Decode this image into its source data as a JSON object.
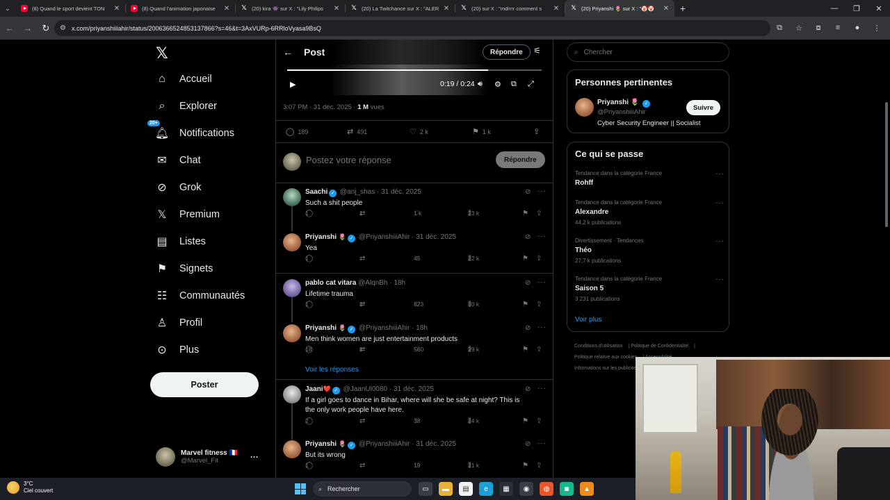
{
  "browser": {
    "tabs": [
      {
        "title": "(8) Quand le sport devient TON",
        "icon": "youtube-icon",
        "active": false
      },
      {
        "title": "(8) Quand l'animation japonaise",
        "icon": "youtube-icon",
        "active": false
      },
      {
        "title": "(20) kira 👾 sur X : \"Lily Philips",
        "icon": "x-icon",
        "active": false
      },
      {
        "title": "(20) La Twitchance sur X : \"ALER",
        "icon": "x-icon",
        "active": false
      },
      {
        "title": "(20) sur X : \"mdrrrr comment s",
        "icon": "x-icon",
        "active": false
      },
      {
        "title": "(20) Priyanshi 🌷 sur X : \"🤡🤡",
        "icon": "x-icon",
        "active": true
      }
    ],
    "url": "x.com/priyanshiiiahir/status/2006366524853137866?s=46&t=3AxVURp-6RRloVyasa9BsQ"
  },
  "nav": {
    "items": [
      {
        "label": "Accueil",
        "icon": "home-icon",
        "glyph": "⌂"
      },
      {
        "label": "Explorer",
        "icon": "search-icon",
        "glyph": "⌕"
      },
      {
        "label": "Notifications",
        "icon": "bell-icon",
        "glyph": "🔔︎"
      },
      {
        "label": "Chat",
        "icon": "mail-icon",
        "glyph": "✉"
      },
      {
        "label": "Grok",
        "icon": "grok-icon",
        "glyph": "⊘"
      },
      {
        "label": "Premium",
        "icon": "x-premium-icon",
        "glyph": "𝕏"
      },
      {
        "label": "Listes",
        "icon": "list-icon",
        "glyph": "▤"
      },
      {
        "label": "Signets",
        "icon": "bookmark-icon",
        "glyph": "⚑"
      },
      {
        "label": "Communautés",
        "icon": "communities-icon",
        "glyph": "☷"
      },
      {
        "label": "Profil",
        "icon": "profile-icon",
        "glyph": "♙"
      },
      {
        "label": "Plus",
        "icon": "more-circle-icon",
        "glyph": "⊙"
      }
    ],
    "notif_badge": "20+",
    "post_button": "Poster",
    "account": {
      "name": "Marvel fitness 🇫🇷",
      "handle": "@Marvel_Fit"
    }
  },
  "post": {
    "header_title": "Post",
    "reply_button": "Répondre",
    "video": {
      "time": "0:19 / 0:24",
      "progress": 0.79
    },
    "timestamp": "3:07 PM · 31 déc. 2025 · ",
    "views_count": "1 M",
    "views_label": " vues",
    "stats": {
      "replies": "189",
      "reposts": "491",
      "likes": "2 k",
      "bookmarks": "1 k"
    },
    "compose_placeholder": "Postez votre réponse",
    "compose_button": "Répondre"
  },
  "replies": [
    {
      "name": "Saachi",
      "handle": "@anj_shas · 31 déc. 2025",
      "text": "Such a shit people",
      "r": "1",
      "rt": "1",
      "l": "1 k",
      "v": "23 k"
    },
    {
      "name": "Priyanshi",
      "emoji": "🌷",
      "handle": "@PriyanshiiiAhir · 31 déc. 2025",
      "text": "Yea",
      "r": "1",
      "rt": "",
      "l": "45",
      "v": "22 k"
    },
    {
      "name": "pablo cat vitara",
      "handle": "@AlqnBh · 18h",
      "text": "Lifetime trauma",
      "r": "1",
      "rt": "3",
      "l": "823",
      "v": "30 k"
    },
    {
      "name": "Priyanshi",
      "emoji": "🌷",
      "handle": "@PriyanshiiiAhir · 18h",
      "text": "Men think women are just entertainment products",
      "r": "18",
      "rt": "8",
      "l": "560",
      "v": "29 k"
    },
    {
      "name": "Jaani",
      "emoji": "❤️",
      "handle": "@JaanUl0080 · 31 déc. 2025",
      "text": "If a girl goes to dance in Bihar, where will she be safe at night? This is the only work people have here.",
      "r": "2",
      "rt": "",
      "l": "38",
      "v": "24 k"
    },
    {
      "name": "Priyanshi",
      "emoji": "🌷",
      "handle": "@PriyanshiiiAhir · 31 déc. 2025",
      "text": "But its wrong",
      "r": "1",
      "rt": "",
      "l": "19",
      "v": "21 k"
    }
  ],
  "see_replies": "Voir les réponses",
  "sidebar": {
    "search_placeholder": "Chercher",
    "relevant": {
      "title": "Personnes pertinentes",
      "name": "Priyanshi 🌷",
      "handle": "@PriyanshiiiAhir",
      "bio": "Cyber Security Engineer || Socialist",
      "follow": "Suivre"
    },
    "trends_title": "Ce qui se passe",
    "trends": [
      {
        "category": "Tendance dans la catégorie France",
        "name": "Rohff",
        "posts": ""
      },
      {
        "category": "Tendance dans la catégorie France",
        "name": "Alexandre",
        "posts": "44,2 k publications"
      },
      {
        "category": "Divertissement · Tendances",
        "name": "Théo",
        "posts": "27,7 k publications"
      },
      {
        "category": "Tendance dans la catégorie France",
        "name": "Saison 5",
        "posts": "3 231 publications"
      }
    ],
    "see_more": "Voir plus",
    "footer": [
      "Conditions d'utilisation",
      "Politique de Confidentialité",
      "Politique relative aux cookies",
      "Accessibilité",
      "Informations sur les publicités"
    ]
  },
  "taskbar": {
    "temp": "3°C",
    "weather": "Ciel couvert",
    "search": "Rechercher"
  }
}
